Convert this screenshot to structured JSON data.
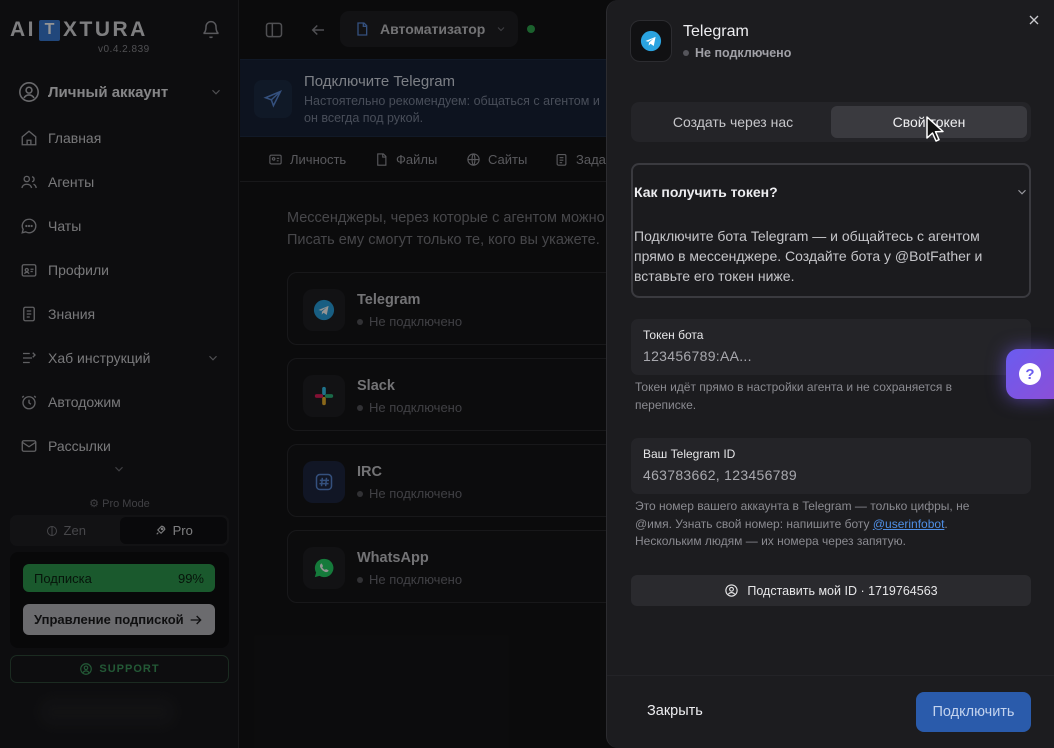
{
  "sidebar": {
    "logo": {
      "left": "AI",
      "mark": "T",
      "right": "XTURA"
    },
    "version": "v0.4.2.839",
    "account_label": "Личный аккаунт",
    "nav": [
      {
        "label": "Главная",
        "icon": "home-icon"
      },
      {
        "label": "Агенты",
        "icon": "users-icon"
      },
      {
        "label": "Чаты",
        "icon": "chat-icon"
      },
      {
        "label": "Профили",
        "icon": "profile-card-icon"
      },
      {
        "label": "Знания",
        "icon": "document-icon"
      },
      {
        "label": "Хаб инструкций",
        "icon": "hub-icon"
      },
      {
        "label": "Автодожим",
        "icon": "clock-icon"
      },
      {
        "label": "Рассылки",
        "icon": "mail-icon"
      }
    ],
    "pro_mode_label": "Pro Mode",
    "modes": {
      "zen": "Zen",
      "pro": "Pro",
      "active": "pro"
    },
    "subscription": {
      "label": "Подписка",
      "percent_text": "99%",
      "percent": 99,
      "manage_label": "Управление подпиской"
    },
    "support_label": "SUPPORT"
  },
  "topbar": {
    "project_name": "Автоматизатор"
  },
  "banner": {
    "title": "Подключите Telegram",
    "text": "Настоятельно рекомендуем: общаться с агентом и он всегда под рукой."
  },
  "tabs": [
    {
      "label": "Личность",
      "icon": "persona-icon"
    },
    {
      "label": "Файлы",
      "icon": "file-icon"
    },
    {
      "label": "Сайты",
      "icon": "globe-icon"
    },
    {
      "label": "Зада",
      "icon": "task-icon"
    }
  ],
  "main": {
    "intro": "Мессенджеры, через которые с агентом можно Писать ему смогут только те, кого вы укажете.",
    "messengers": [
      {
        "name": "Telegram",
        "status": "Не подключено"
      },
      {
        "name": "Slack",
        "status": "Не подключено"
      },
      {
        "name": "IRC",
        "status": "Не подключено"
      },
      {
        "name": "WhatsApp",
        "status": "Не подключено"
      }
    ]
  },
  "panel": {
    "title": "Telegram",
    "status": "Не подключено",
    "segments": {
      "option1": "Создать через нас",
      "option2": "Свой токен",
      "active": "option2"
    },
    "howto": {
      "title": "Как получить токен?",
      "text": "Подключите бота Telegram — и общайтесь с агентом прямо в мессенджере. Создайте бота у @BotFather и вставьте его токен ниже."
    },
    "token_field": {
      "label": "Токен бота",
      "placeholder": "123456789:AA...",
      "hint": "Токен идёт прямо в настройки агента и не сохраняется в переписке."
    },
    "id_field": {
      "label": "Ваш Telegram ID",
      "placeholder": "463783662, 123456789",
      "hint_before": "Это номер вашего аккаунта в Telegram — только цифры, не @имя. Узнать свой номер: напишите боту ",
      "hint_link": "@userinfobot",
      "hint_after": ". Нескольким людям — их номера через запятую."
    },
    "substitute_label": "Подставить мой ID · 1719764563",
    "close_label": "Закрыть",
    "connect_label": "Подключить"
  },
  "help_fab_label": "?",
  "colors": {
    "accent": "#2a5bab",
    "telegram": "#2aa3e0",
    "subscription": "#2e9a4f",
    "online": "#2fa84f",
    "help": "#7a55e6"
  }
}
